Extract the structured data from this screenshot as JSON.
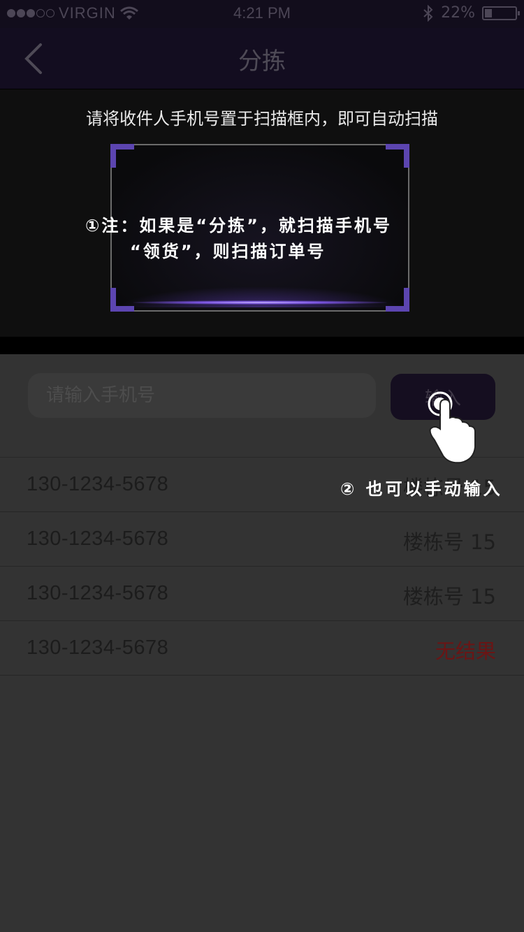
{
  "status_bar": {
    "carrier": "VIRGIN",
    "time": "4:21 PM",
    "battery": "22%",
    "battery_level": 0.22,
    "signal_dots": [
      true,
      true,
      true,
      false,
      false
    ]
  },
  "nav": {
    "title": "分拣"
  },
  "scanner": {
    "hint": "请将收件人手机号置于扫描框内，即可自动扫描",
    "accent_color": "#5c45b0"
  },
  "annotations": {
    "note_1": "①注：如果是“分拣”，就扫描手机号",
    "note_2": "“领货”，则扫描订单号",
    "note_3": "② 也可以手动输入"
  },
  "input": {
    "placeholder": "请输入手机号",
    "submit_label": "输入"
  },
  "results": [
    {
      "phone": "130-1234-5678",
      "status": "楼栋号 15",
      "found": true
    },
    {
      "phone": "130-1234-5678",
      "status": "楼栋号 15",
      "found": true
    },
    {
      "phone": "130-1234-5678",
      "status": "楼栋号 15",
      "found": true
    },
    {
      "phone": "130-1234-5678",
      "status": "无结果",
      "found": false
    }
  ],
  "colors": {
    "background": "#333333",
    "nav_background": "#130d20",
    "no_result": "#6a1515"
  }
}
